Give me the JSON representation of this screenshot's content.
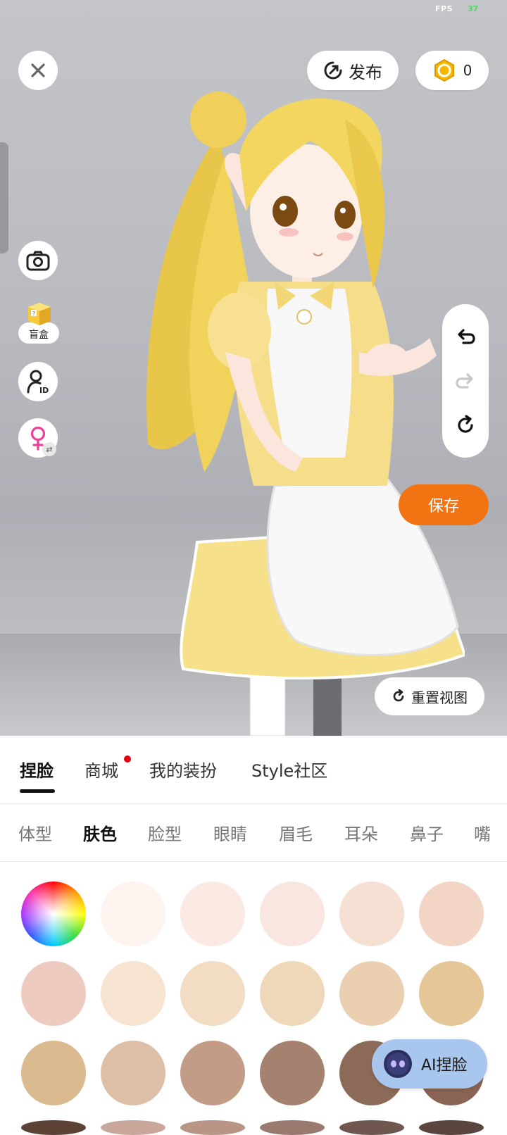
{
  "status": {
    "fps_label": "FPS",
    "fps_value": "37"
  },
  "top_bar": {
    "publish_label": "发布",
    "coin_count": "0"
  },
  "side_tools": {
    "blind_box_label": "盲盒"
  },
  "actions": {
    "save_label": "保存",
    "reset_view_label": "重置视图",
    "ai_face_label": "AI捏脸"
  },
  "main_tabs": [
    {
      "label": "捏脸",
      "active": true
    },
    {
      "label": "商城",
      "badge": true
    },
    {
      "label": "我的装扮"
    },
    {
      "label": "Style社区"
    }
  ],
  "sub_tabs": [
    {
      "label": "体型"
    },
    {
      "label": "肤色",
      "active": true
    },
    {
      "label": "脸型"
    },
    {
      "label": "眼睛"
    },
    {
      "label": "眉毛"
    },
    {
      "label": "耳朵"
    },
    {
      "label": "鼻子"
    },
    {
      "label": "嘴"
    }
  ],
  "skin_colors": [
    "#fdf3ef",
    "#fbe9e3",
    "#f9e6e1",
    "#f6e0d4",
    "#f2d5c5",
    "#edcbc1",
    "#f6e3d0",
    "#f3dcc4",
    "#efd7b9",
    "#ebcfb1",
    "#e5c697",
    "#dbba8f",
    "#ddbfa8",
    "#c29c86",
    "#a58270",
    "#8b6a58",
    "#8a6454",
    "#5c4234",
    "#c9a89b",
    "#b99585",
    "#9a7a6e",
    "#6f5750",
    "#5a463f"
  ],
  "colors": {
    "accent": "#f27312",
    "ai_button": "#a9c7ee",
    "badge_red": "#e60012"
  }
}
